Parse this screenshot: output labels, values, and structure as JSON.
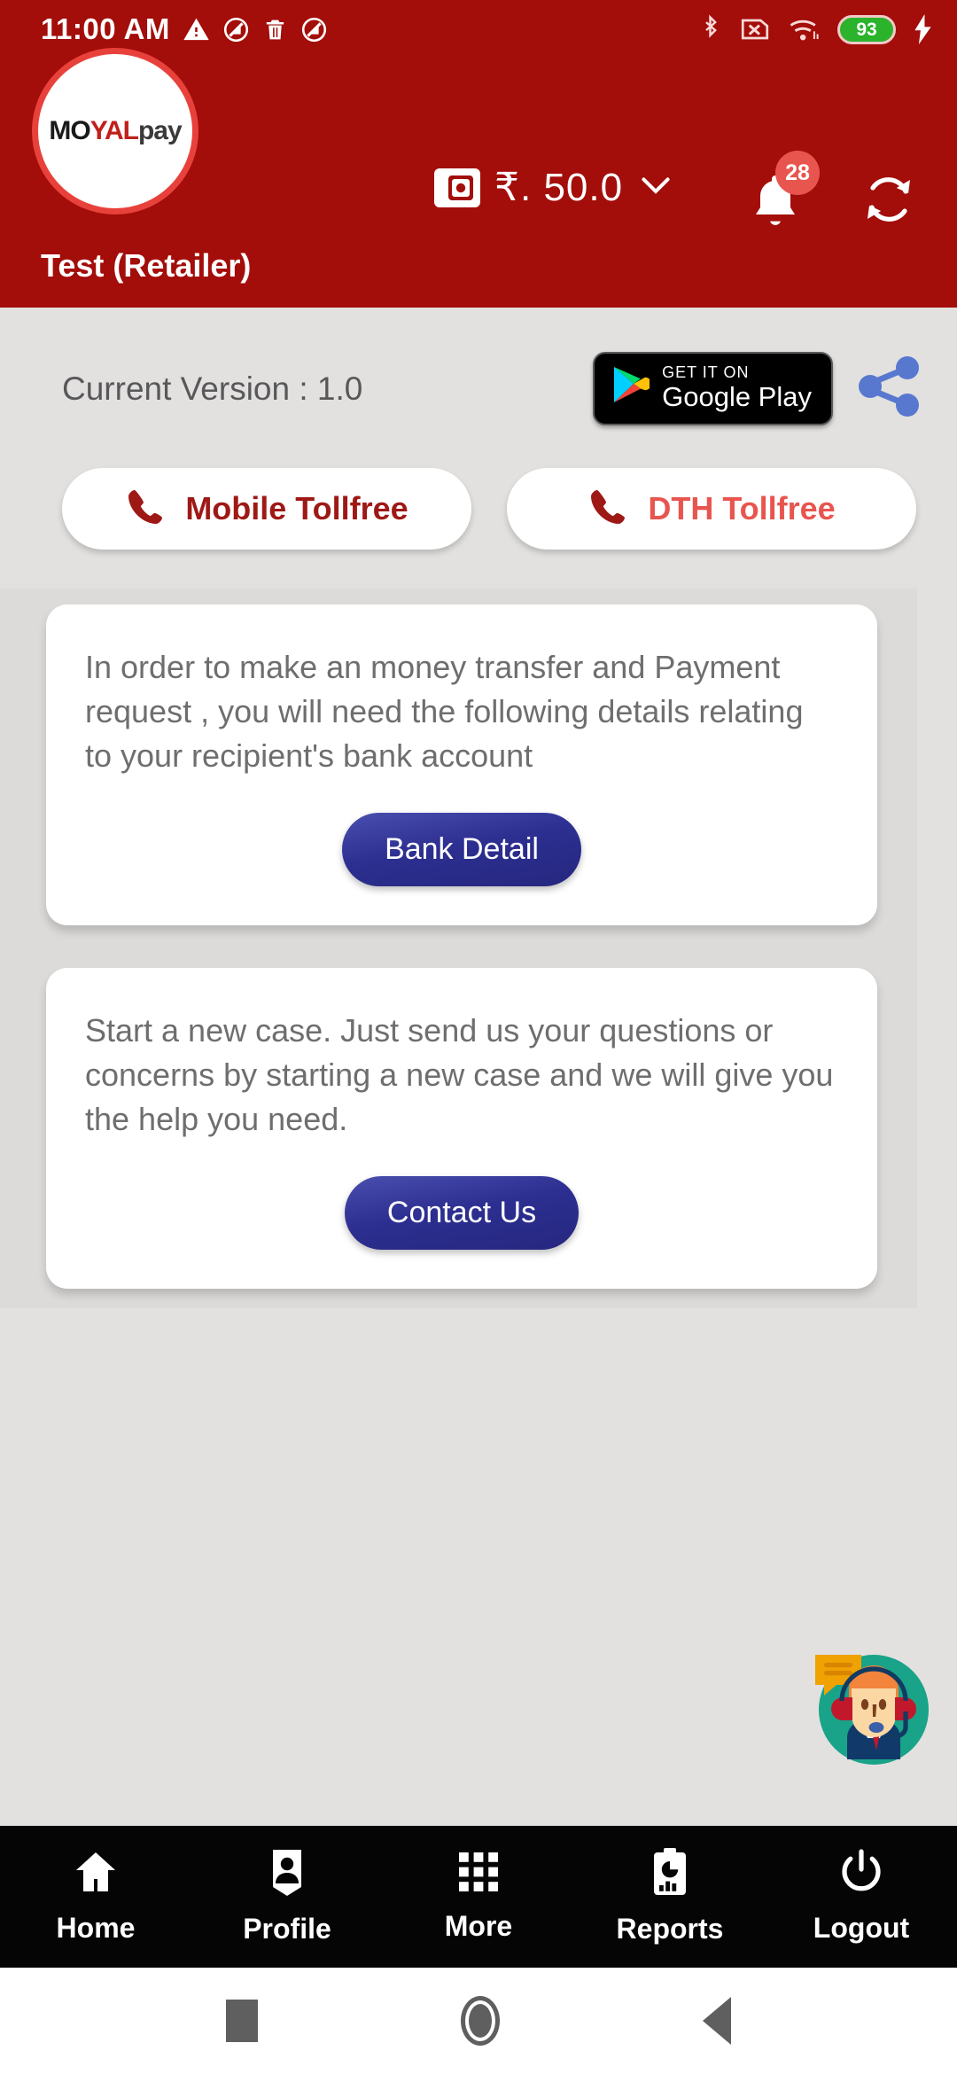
{
  "statusbar": {
    "time": "11:00 AM",
    "left_icons": [
      "warning-icon",
      "do-not-disturb-icon",
      "trash-icon",
      "do-not-disturb-icon"
    ],
    "right_icons": [
      "bluetooth-icon",
      "sim-card-off-icon",
      "wifi-icon",
      "battery-icon",
      "charging-bolt-icon"
    ],
    "battery_level": "93"
  },
  "header": {
    "logo": {
      "part1": "MO",
      "part2": "YAL",
      "part3": "pay"
    },
    "wallet_icon": "wallet-icon",
    "balance": "₹. 50.0",
    "chevron": "⌄",
    "notification_count": "28",
    "bell_icon": "bell-icon",
    "sync_icon": "sync-refresh-icon",
    "role_label": "Test (Retailer)",
    "accent_color": "#a30d0a"
  },
  "main": {
    "version_label": "Current Version : 1.0",
    "google_play": {
      "small": "GET IT ON",
      "big": "Google Play"
    },
    "share_icon": "share-icon",
    "tollfree": [
      {
        "label": "Mobile Tollfree",
        "icon": "phone-icon",
        "color": "#9e1915"
      },
      {
        "label": "DTH Tollfree",
        "icon": "phone-icon",
        "color": "#e8554f"
      }
    ],
    "cards": [
      {
        "text": "In order to make an money transfer and Payment request , you will need the following details relating to your recipient's bank account",
        "button": "Bank Detail"
      },
      {
        "text": "Start a new case. Just send us your questions or concerns by starting a new case and we will give you the help you need.",
        "button": "Contact Us"
      }
    ],
    "support_icon": "customer-support-agent-icon"
  },
  "bottom_nav": [
    {
      "label": "Home",
      "icon": "home-icon"
    },
    {
      "label": "Profile",
      "icon": "profile-badge-icon"
    },
    {
      "label": "More",
      "icon": "grid-apps-icon"
    },
    {
      "label": "Reports",
      "icon": "report-clipboard-icon"
    },
    {
      "label": "Logout",
      "icon": "power-icon"
    }
  ],
  "android_nav": [
    {
      "name": "recents-button",
      "icon": "square-icon"
    },
    {
      "name": "home-button",
      "icon": "circle-icon"
    },
    {
      "name": "back-button",
      "icon": "triangle-back-icon"
    }
  ]
}
